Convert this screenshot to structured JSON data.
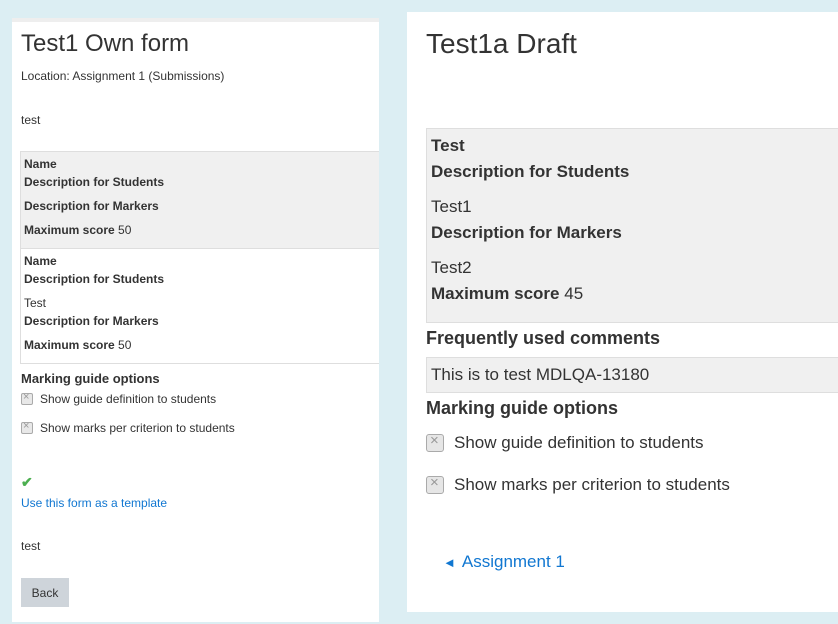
{
  "left": {
    "title": "Test1 Own form",
    "location": "Location: Assignment 1 (Submissions)",
    "description": "test",
    "criteria": [
      {
        "name_label": "Name",
        "name_value": "",
        "desc_students_label": "Description for Students",
        "desc_students_value": "",
        "desc_markers_label": "Description for Markers",
        "desc_markers_value": "",
        "max_score_label": "Maximum score",
        "max_score_value": "50"
      },
      {
        "name_label": "Name",
        "name_value": "",
        "desc_students_label": "Description for Students",
        "desc_students_value": "Test",
        "desc_markers_label": "Description for Markers",
        "desc_markers_value": "",
        "max_score_label": "Maximum score",
        "max_score_value": "50"
      }
    ],
    "options_heading": "Marking guide options",
    "options": [
      "Show guide definition to students",
      "Show marks per criterion to students"
    ],
    "check_icon": "check-icon",
    "template_link": "Use this form as a template",
    "footer_text": "test",
    "back_button": "Back"
  },
  "right": {
    "title": "Test1a Draft",
    "criterion": {
      "name_value": "Test",
      "desc_students_label": "Description for Students",
      "desc_students_value": "Test1",
      "desc_markers_label": "Description for Markers",
      "desc_markers_value": "Test2",
      "max_score_label": "Maximum score",
      "max_score_value": "45"
    },
    "comments_heading": "Frequently used comments",
    "comment": "This is to test MDLQA-13180",
    "options_heading": "Marking guide options",
    "options": [
      "Show guide definition to students",
      "Show marks per criterion to students"
    ],
    "nav_link": "Assignment 1",
    "nav_icon": "left-arrow-icon"
  },
  "colors": {
    "background": "#dceef3",
    "link": "#1177d1",
    "shaded": "#f0f0f0",
    "check": "#4caf50"
  }
}
